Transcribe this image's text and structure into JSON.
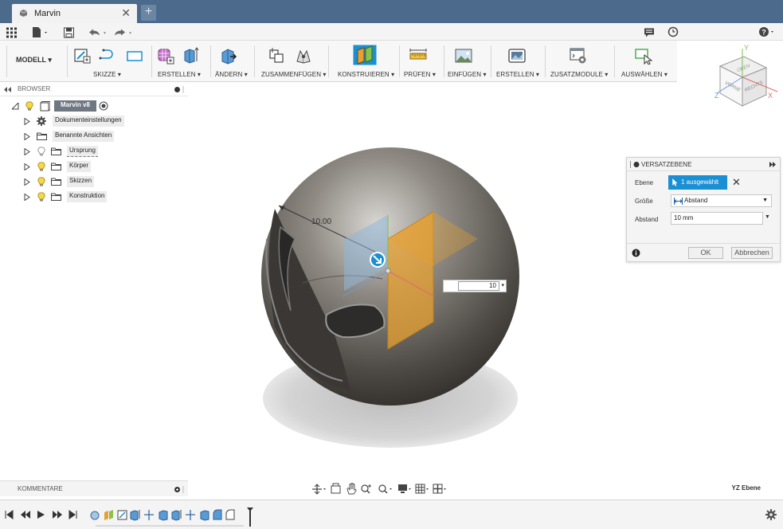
{
  "tab": {
    "title": "Marvin",
    "close": "✕",
    "new": "+"
  },
  "ribbon": {
    "modell": "MODELL ▾",
    "groups": [
      "SKIZZE ▾",
      "ERSTELLEN ▾",
      "ÄNDERN ▾",
      "ZUSAMMENFÜGEN ▾",
      "KONSTRUIEREN ▾",
      "PRÜFEN ▾",
      "EINFÜGEN ▾",
      "ERSTELLEN ▾",
      "ZUSATZMODULE ▾",
      "AUSWÄHLEN ▾"
    ]
  },
  "viewcube": {
    "top": "OBEN",
    "front": "VORNE",
    "right": "RECHTS",
    "x": "X",
    "y": "Y",
    "z": "Z"
  },
  "browser": {
    "header": "BROWSER",
    "root": "Marvin v8",
    "items": [
      "Dokumenteinstellungen",
      "Benannte Ansichten",
      "Ursprung",
      "Körper",
      "Skizzen",
      "Konstruktion"
    ]
  },
  "dialog": {
    "title": "VERSATZEBENE",
    "ebene_label": "Ebene",
    "ebene_value": "1 ausgewählt",
    "groesse_label": "Größe",
    "groesse_value": "Abstand",
    "abstand_label": "Abstand",
    "abstand_value": "10 mm",
    "ok": "OK",
    "cancel": "Abbrechen"
  },
  "viewport": {
    "dimension_text": "10.00",
    "input_value": "10"
  },
  "status": {
    "comments": "KOMMENTARE",
    "active_plane": "YZ Ebene"
  },
  "colors": {
    "tabbar": "#4c6a8b",
    "accent": "#1a8fd4",
    "plane_orange": "#e8a030",
    "plane_blue": "#8fb6d8"
  }
}
